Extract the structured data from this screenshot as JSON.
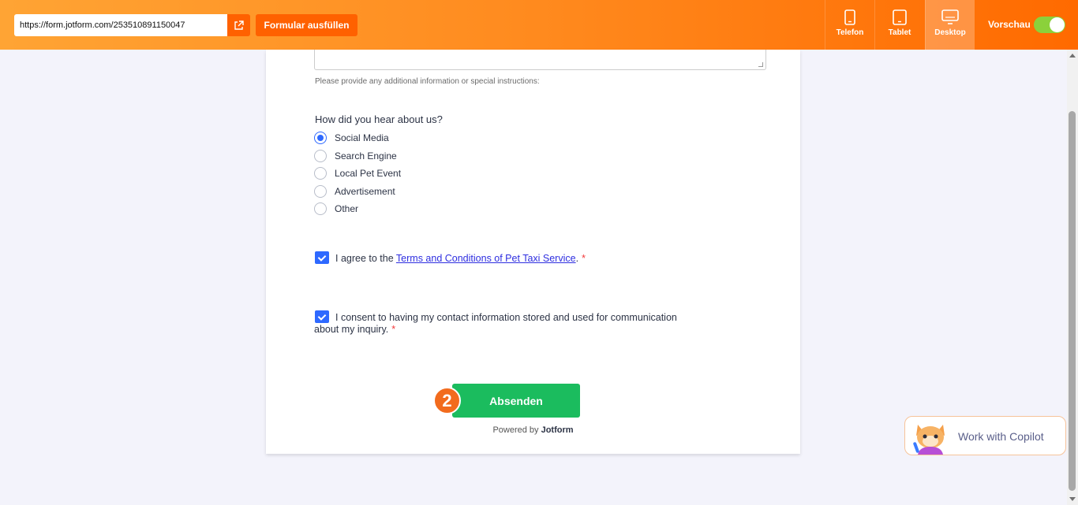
{
  "topbar": {
    "url": "https://form.jotform.com/253510891150047",
    "fill_button": "Formular ausfüllen",
    "devices": [
      {
        "label": "Telefon",
        "icon": "phone-icon"
      },
      {
        "label": "Tablet",
        "icon": "tablet-icon"
      },
      {
        "label": "Desktop",
        "icon": "desktop-icon",
        "active": true
      }
    ],
    "preview_label": "Vorschau",
    "preview_on": true
  },
  "form": {
    "hint": "Please provide any additional information or special instructions:",
    "question": "How did you hear about us?",
    "options": [
      "Social Media",
      "Search Engine",
      "Local Pet Event",
      "Advertisement",
      "Other"
    ],
    "selected_option": "Social Media",
    "terms": {
      "prefix": "I agree to the",
      "link": "Terms and Conditions of Pet Taxi Service",
      "suffix": ".",
      "required": "*",
      "checked": true
    },
    "consent": {
      "text": "I consent to having my contact information stored and used for communication about my inquiry.",
      "required": "*",
      "checked": true
    },
    "submit_label": "Absenden",
    "step_badge": "2",
    "powered_prefix": "Powered by",
    "powered_brand": "Jotform"
  },
  "copilot": {
    "label": "Work with Copilot"
  },
  "colors": {
    "accent": "#ff6100",
    "submit": "#1bbc5e",
    "checkbox": "#2e69ff",
    "required": "#f23a3c"
  }
}
